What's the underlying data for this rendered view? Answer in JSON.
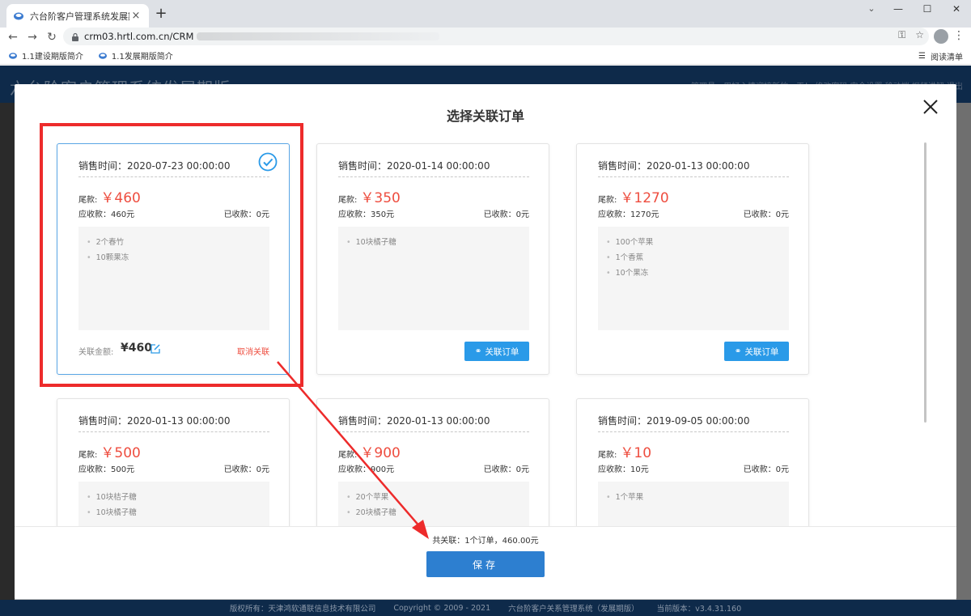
{
  "browser": {
    "tab_title": "六台阶客户管理系统发展期版",
    "url": "crm03.hrtl.com.cn/CRM",
    "bookmarks": [
      "1.1建设期版简介",
      "1.1发展期版简介"
    ],
    "reading_list": "阅读清单"
  },
  "app": {
    "title": "六台阶客户管理系统发展期版",
    "header_right": "管理员，用好心情迎接新的一天！   修改密码   安全设置   移动端   视频讲解   退出",
    "footer": {
      "owner": "版权所有：天津鸿软通联信息技术有限公司",
      "copyright": "Copyright © 2009 - 2021",
      "system": "六台阶客户关系管理系统（发展期版）",
      "version": "当前版本：v3.4.31.160"
    }
  },
  "modal": {
    "title": "选择关联订单",
    "summary": "共关联：1个订单，460.00元",
    "save_label": "保存",
    "labels": {
      "balance": "尾款:",
      "assoc_amount": "关联金额:",
      "cancel_assoc": "取消关联",
      "link_order": "关联订单"
    },
    "orders": [
      {
        "date": "销售时间：2020-07-23 00:00:00",
        "balance": "￥460",
        "receivable": "应收款：460元",
        "received": "已收款：0元",
        "items": [
          "2个春竹",
          "10颗果冻"
        ],
        "selected": true,
        "assoc_amount": "¥460"
      },
      {
        "date": "销售时间：2020-01-14 00:00:00",
        "balance": "￥350",
        "receivable": "应收款：350元",
        "received": "已收款：0元",
        "items": [
          "10块橘子糖"
        ],
        "selected": false
      },
      {
        "date": "销售时间：2020-01-13 00:00:00",
        "balance": "￥1270",
        "receivable": "应收款：1270元",
        "received": "已收款：0元",
        "items": [
          "100个苹果",
          "1个香蕉",
          "10个果冻"
        ],
        "selected": false
      },
      {
        "date": "销售时间：2020-01-13 00:00:00",
        "balance": "￥500",
        "receivable": "应收款：500元",
        "received": "已收款：0元",
        "items": [
          "10块桔子糖",
          "10块橘子糖"
        ],
        "selected": false
      },
      {
        "date": "销售时间：2020-01-13 00:00:00",
        "balance": "￥900",
        "receivable": "应收款：900元",
        "received": "已收款：0元",
        "items": [
          "20个苹果",
          "20块橘子糖"
        ],
        "selected": false
      },
      {
        "date": "销售时间：2019-09-05 00:00:00",
        "balance": "￥10",
        "receivable": "应收款：10元",
        "received": "已收款：0元",
        "items": [
          "1个苹果"
        ],
        "selected": false
      }
    ]
  },
  "colors": {
    "accent": "#2a9ae8",
    "save": "#2d7fd0",
    "amount_red": "#ee4d3f",
    "annotation_red": "#ed2b2b",
    "header_navy": "#0e2a4a"
  }
}
